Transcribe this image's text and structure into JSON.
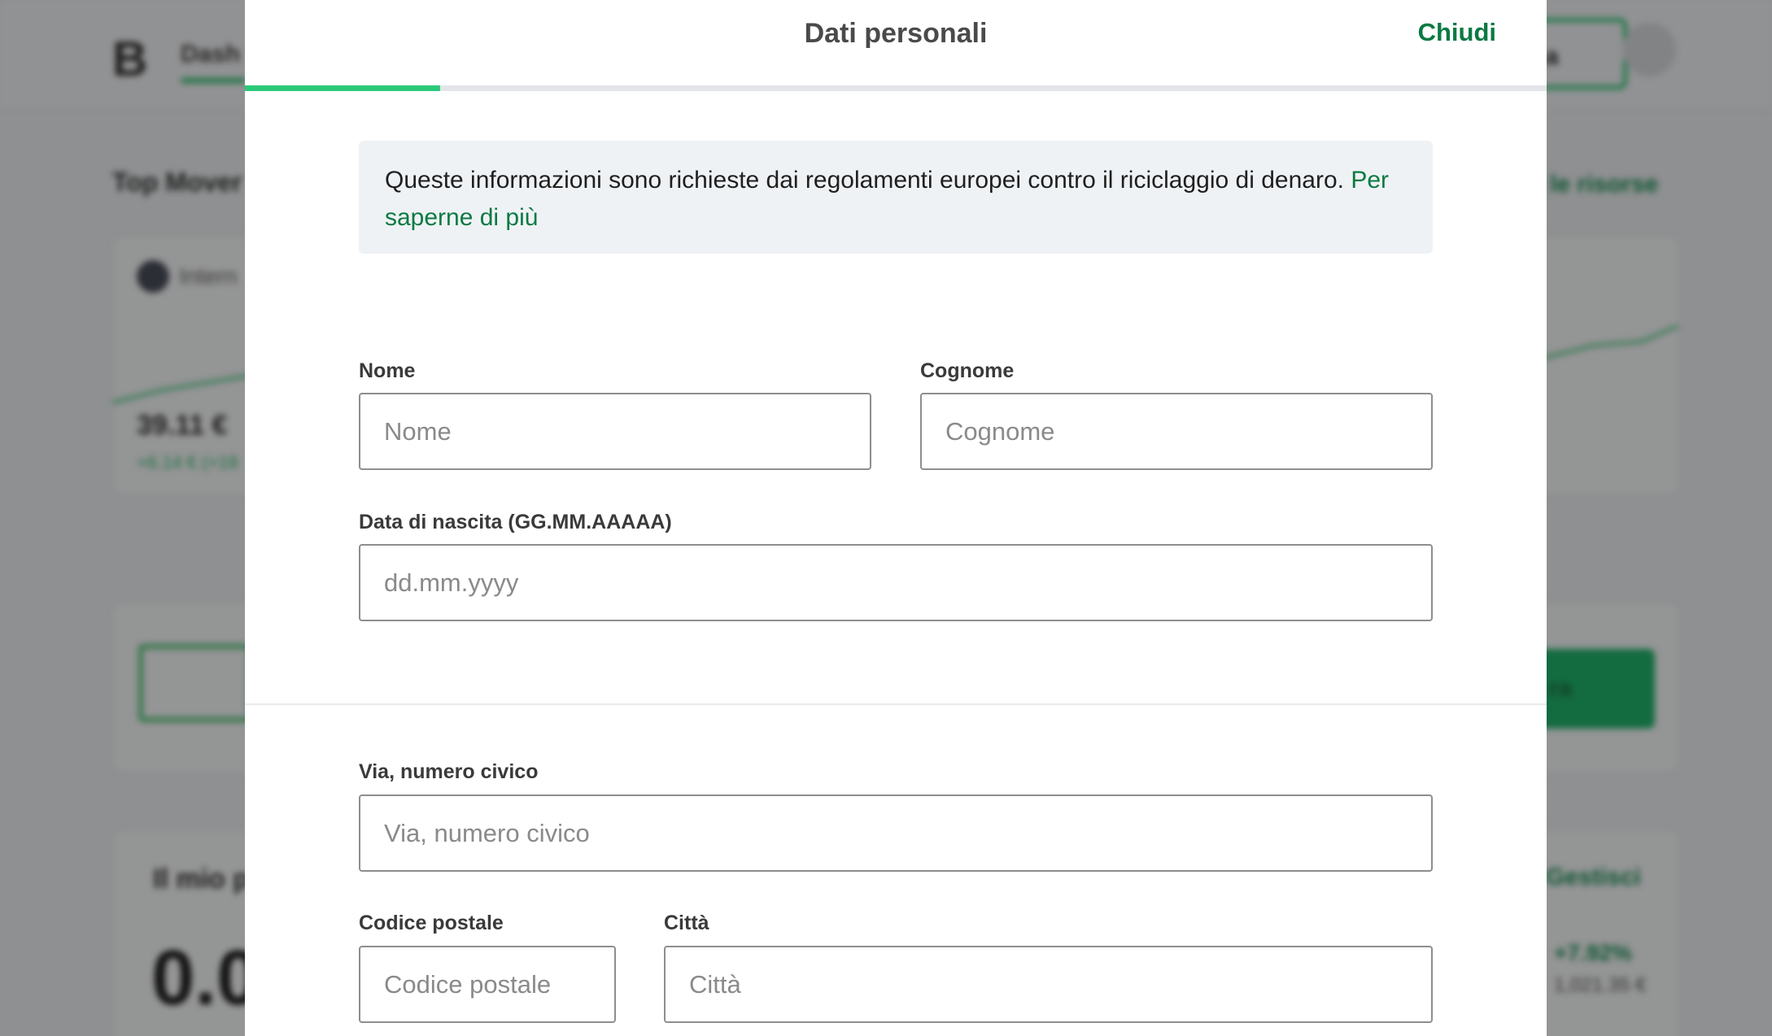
{
  "background": {
    "logo": "B",
    "nav_label": "Dash",
    "cta_label": "a",
    "section_title": "Top Mover",
    "section_link": "e le risorse",
    "coin_name": "Intern",
    "coin_price": "39.11 €",
    "coin_change": "+6.14 € (+18",
    "green_button_label": "ra",
    "portfolio_title": "Il mio p",
    "portfolio_value": "0.0",
    "manage_link": "Gestisci",
    "portfolio_pct": "+7.92%",
    "portfolio_amount": "1,021.35 €"
  },
  "modal": {
    "title": "Dati personali",
    "close_label": "Chiudi",
    "progress_percent": 15,
    "info": {
      "text": "Queste informazioni sono richieste dai regolamenti europei contro il riciclaggio di denaro.",
      "link": "Per saperne di più"
    },
    "fields": {
      "first_name": {
        "label": "Nome",
        "placeholder": "Nome",
        "value": ""
      },
      "last_name": {
        "label": "Cognome",
        "placeholder": "Cognome",
        "value": ""
      },
      "birth_date": {
        "label": "Data di nascita (GG.MM.AAAAA)",
        "placeholder": "dd.mm.yyyy",
        "value": ""
      },
      "street": {
        "label": "Via, numero civico",
        "placeholder": "Via, numero civico",
        "value": ""
      },
      "postal_code": {
        "label": "Codice postale",
        "placeholder": "Codice postale",
        "value": ""
      },
      "city": {
        "label": "Città",
        "placeholder": "Città",
        "value": ""
      }
    }
  },
  "colors": {
    "accent": "#0b7a43",
    "progress": "#2dc97a",
    "info_bg": "#eff2f5"
  }
}
